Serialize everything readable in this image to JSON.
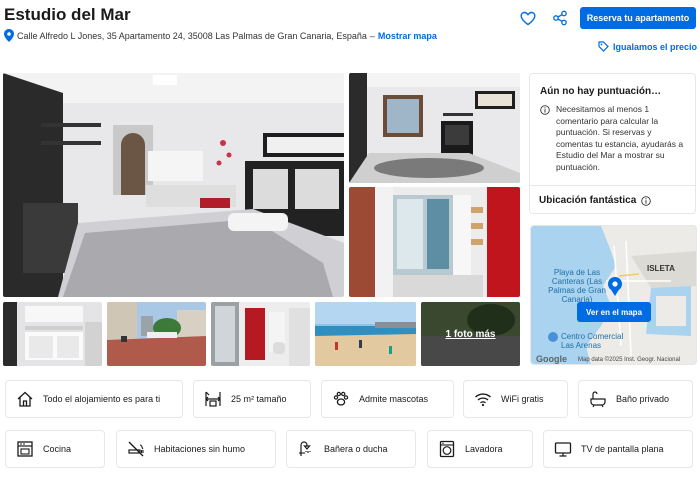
{
  "header": {
    "title": "Estudio del Mar",
    "address": "Calle Alfredo L Jones, 35 Apartamento 24, 35008 Las Palmas de Gran Canaria, España",
    "separator": "–",
    "show_map_link": "Mostrar mapa",
    "reserve_button": "Reserva tu apartamento",
    "price_match": "Igualamos el precio",
    "accent_color": "#006ce4"
  },
  "gallery": {
    "more_photos": "1 foto más"
  },
  "score_card": {
    "title": "Aún no hay puntuación…",
    "text": "Necesitamos al menos 1 comentario para calcular la puntuación. Si reservas y comentas tu estancia, ayudarás a Estudio del Mar a mostrar su puntuación.",
    "location_label": "Ubicación fantástica"
  },
  "map": {
    "label_beach": "Playa de Las Canteras (Las Palmas de Gran Canaria)",
    "label_isleta": "ISLETA",
    "label_mall": "Centro Comercial Las Arenas",
    "show_on_map": "Ver en el mapa",
    "google": "Google",
    "map_data": "Map data ©2025 Inst. Geogr. Nacional"
  },
  "facilities": [
    {
      "label": "Todo el alojamiento es para ti",
      "icon": "house-icon"
    },
    {
      "label": "25 m² tamaño",
      "icon": "size-icon"
    },
    {
      "label": "Admite mascotas",
      "icon": "paw-icon"
    },
    {
      "label": "WiFi gratis",
      "icon": "wifi-icon"
    },
    {
      "label": "Baño privado",
      "icon": "bath-icon"
    },
    {
      "label": "Cocina",
      "icon": "stove-icon"
    },
    {
      "label": "Habitaciones sin humo",
      "icon": "no-smoking-icon"
    },
    {
      "label": "Bañera o ducha",
      "icon": "shower-icon"
    },
    {
      "label": "Lavadora",
      "icon": "washer-icon"
    },
    {
      "label": "TV de pantalla plana",
      "icon": "tv-icon"
    }
  ]
}
